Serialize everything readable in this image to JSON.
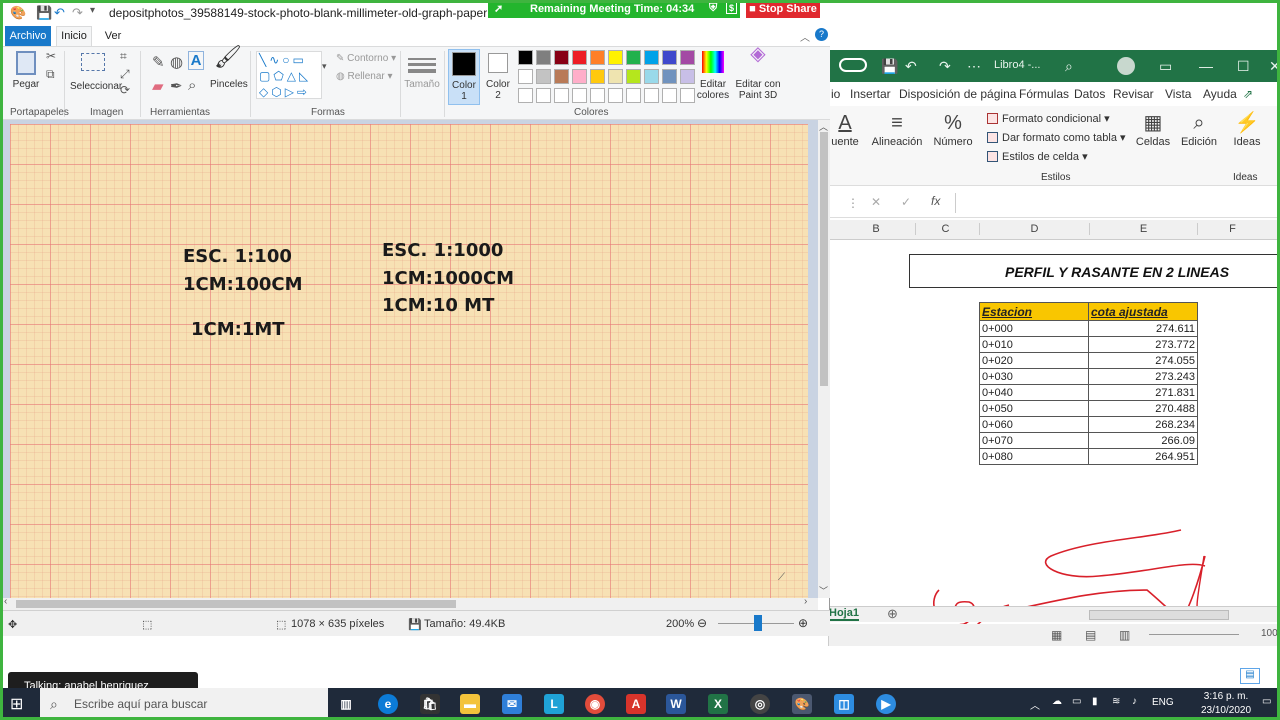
{
  "meeting": {
    "remaining": "Remaining Meeting Time: 04:34",
    "stop": "Stop Share",
    "talking": "Talking: anabel henriquez"
  },
  "paint": {
    "title": "depositphotos_39588149-stock-photo-blank-millimeter-old-graph-paper - Paint",
    "tabs": [
      "Archivo",
      "Inicio",
      "Ver"
    ],
    "ribbon": {
      "paste": "Pegar",
      "select": "Seleccionar",
      "brushes": "Pinceles",
      "outline": "Contorno",
      "fill": "Rellenar",
      "size": "Tamaño",
      "color1": "Color 1",
      "color2": "Color 2",
      "edit_colors": "Editar colores",
      "paint3d": "Editar con Paint 3D",
      "groups": [
        "Portapapeles",
        "Imagen",
        "Herramientas",
        "Formas",
        "Colores"
      ]
    },
    "palette_row1": [
      "#000000",
      "#7f7f7f",
      "#880015",
      "#ed1c24",
      "#ff7f27",
      "#fff200",
      "#22b14c",
      "#00a2e8",
      "#3f48cc",
      "#a349a4"
    ],
    "palette_row2": [
      "#ffffff",
      "#c3c3c3",
      "#b97a57",
      "#ffaec9",
      "#ffc90e",
      "#efe4b0",
      "#b5e61d",
      "#99d9ea",
      "#7092be",
      "#c8bfe7"
    ],
    "canvas_text": {
      "left": [
        "ESC. 1:100",
        "1CM:100CM",
        "1CM:1MT"
      ],
      "right": [
        "ESC. 1:1000",
        "1CM:1000CM",
        "1CM:10 MT"
      ]
    },
    "status": {
      "dimensions": "1078 × 635 píxeles",
      "size": "Tamaño: 49.4KB",
      "zoom": "200%"
    }
  },
  "excel": {
    "filename": "Libro4 -...",
    "menu": [
      "io",
      "Insertar",
      "Disposición de página",
      "Fórmulas",
      "Datos",
      "Revisar",
      "Vista",
      "Ayuda"
    ],
    "ribbon": {
      "fuente": "uente",
      "alineacion": "Alineación",
      "numero": "Número",
      "cond": "Formato condicional",
      "table": "Dar formato como tabla",
      "cellstyles": "Estilos de celda",
      "estilos": "Estilos",
      "celdas": "Celdas",
      "edicion": "Edición",
      "ideas": "Ideas",
      "ideas_grp": "Ideas"
    },
    "columns": [
      "B",
      "C",
      "D",
      "E",
      "F"
    ],
    "sheet_title": "PERFIL Y RASANTE EN 2 LINEAS",
    "table": {
      "headers": [
        "Estacion",
        "cota ajustada"
      ],
      "rows": [
        [
          "0+000",
          "274.611"
        ],
        [
          "0+010",
          "273.772"
        ],
        [
          "0+020",
          "274.055"
        ],
        [
          "0+030",
          "273.243"
        ],
        [
          "0+040",
          "271.831"
        ],
        [
          "0+050",
          "270.488"
        ],
        [
          "0+060",
          "268.234"
        ],
        [
          "0+070",
          "266.09"
        ],
        [
          "0+080",
          "264.951"
        ]
      ]
    },
    "sheet_tab": "Hoja1",
    "zoom": "100"
  },
  "taskbar": {
    "search": "Escribe aquí para buscar",
    "time": "3:16 p. m.",
    "date": "23/10/2020",
    "lang": "ENG"
  }
}
